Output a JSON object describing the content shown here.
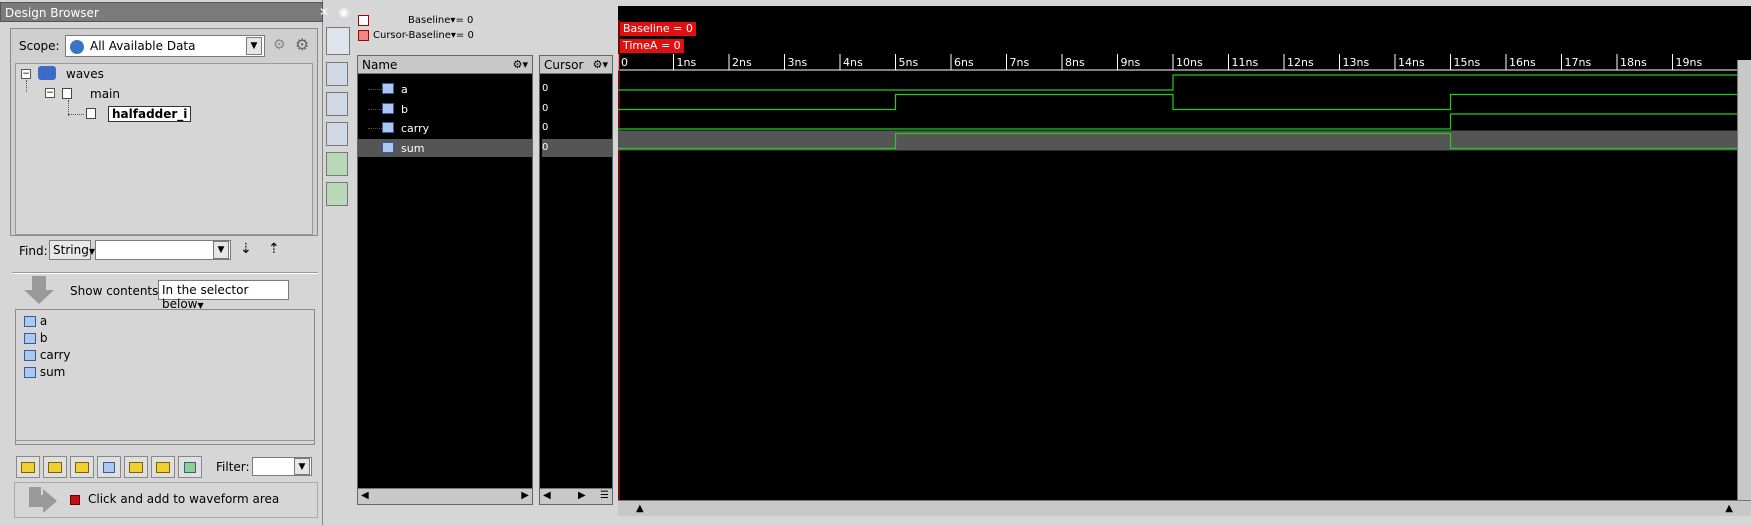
{
  "design_browser": {
    "title": "Design Browser",
    "scope_label": "Scope:",
    "scope_value": "All Available Data",
    "tree": [
      {
        "label": "waves",
        "level": 0
      },
      {
        "label": "main",
        "level": 1
      },
      {
        "label": "halfadder_i",
        "level": 2
      }
    ],
    "find_label": "Find:",
    "find_type": "String",
    "find_value": "",
    "show_contents_label": "Show contents:",
    "show_contents_value": "In the selector below",
    "signals": [
      "a",
      "b",
      "carry",
      "sum"
    ],
    "filter_label": "Filter:",
    "filter_value": "",
    "add_hint": "Click and add to waveform area"
  },
  "waveform": {
    "baseline_label": "Baseline",
    "baseline_value": "= 0",
    "cursor_baseline_label": "Cursor-Baseline",
    "cursor_baseline_value": "= 0",
    "name_header": "Name",
    "cursor_header": "Cursor",
    "baseline_tag": "Baseline = 0",
    "timea_tag": "TimeA = 0",
    "ticks": [
      "0",
      "1ns",
      "2ns",
      "3ns",
      "4ns",
      "5ns",
      "6ns",
      "7ns",
      "8ns",
      "9ns",
      "10ns",
      "11ns",
      "12ns",
      "13ns",
      "14ns",
      "15ns",
      "16ns",
      "17ns",
      "18ns",
      "19ns"
    ],
    "signals": [
      {
        "name": "a",
        "cursor": "0",
        "transitions": [
          [
            0,
            0
          ],
          [
            10,
            1
          ]
        ]
      },
      {
        "name": "b",
        "cursor": "0",
        "transitions": [
          [
            0,
            0
          ],
          [
            5,
            1
          ],
          [
            10,
            0
          ],
          [
            15,
            1
          ]
        ]
      },
      {
        "name": "carry",
        "cursor": "0",
        "transitions": [
          [
            0,
            0
          ],
          [
            15,
            1
          ]
        ]
      },
      {
        "name": "sum",
        "cursor": "0",
        "transitions": [
          [
            0,
            0
          ],
          [
            5,
            1
          ],
          [
            15,
            0
          ]
        ]
      }
    ],
    "selected_signal": "sum",
    "colors": {
      "trace": "#22cc22",
      "tag": "#e01010",
      "selected_row": "#555555"
    }
  }
}
